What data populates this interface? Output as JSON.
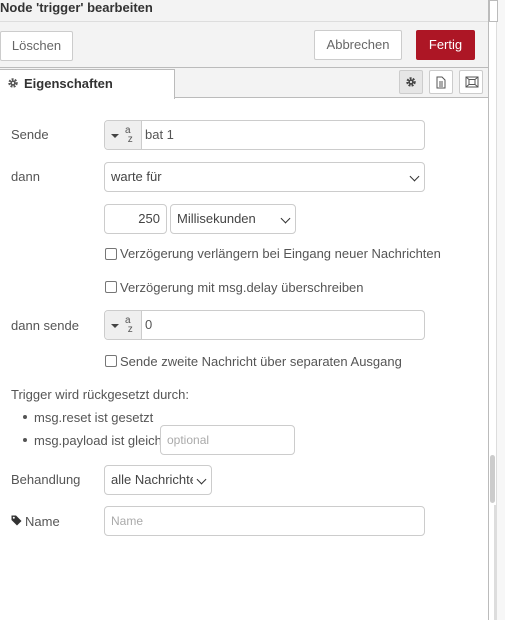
{
  "tray": {
    "title": "Node 'trigger' bearbeiten",
    "delete_label": "Löschen",
    "cancel_label": "Abbrechen",
    "done_label": "Fertig"
  },
  "tabs": {
    "properties_label": "Eigenschaften",
    "icons": [
      "settings-icon",
      "description-icon",
      "appearance-icon"
    ]
  },
  "form": {
    "send_label": "Sende",
    "send_value": "bat 1",
    "then_label": "dann",
    "then_value": "warte für",
    "duration_value": "250",
    "duration_unit": "Millisekunden",
    "extend_label": "Verzögerung verlängern bei Eingang neuer Nachrichten",
    "override_label": "Verzögerung mit msg.delay überschreiben",
    "then_send_label": "dann sende",
    "then_send_value": "0",
    "second_output_label": "Sende zweite Nachricht über separaten Ausgang",
    "reset_heading": "Trigger wird rückgesetzt durch:",
    "reset_item_1": "msg.reset ist gesetzt",
    "reset_item_2": "msg.payload ist gleich",
    "reset_placeholder": "optional",
    "handling_label": "Behandlung",
    "handling_value": "alle Nachrichten",
    "name_label": "Name",
    "name_placeholder": "Name"
  },
  "colors": {
    "primary": "#ad1625",
    "header_bg": "#f3f3f3"
  }
}
